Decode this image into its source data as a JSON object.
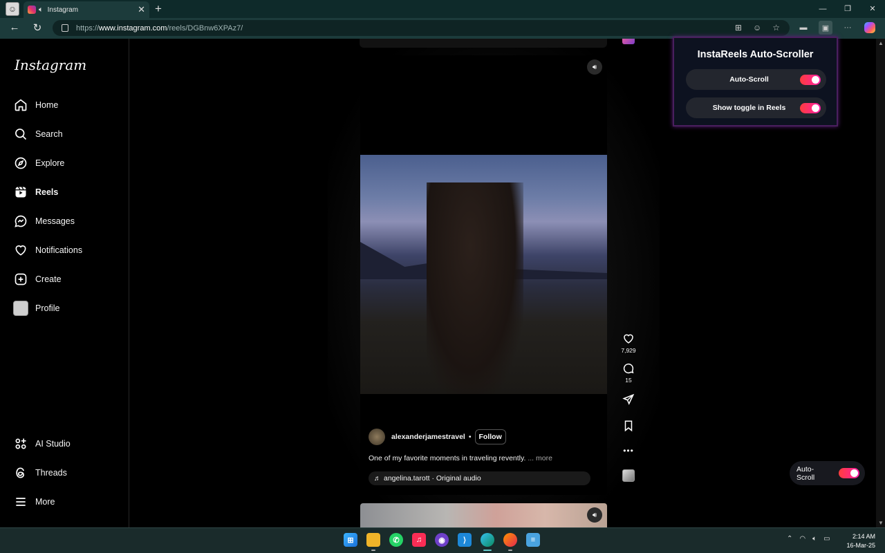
{
  "browser": {
    "tab_title": "Instagram",
    "url_prefix": "https://",
    "url_domain": "www.instagram.com",
    "url_path": "/reels/DGBnw6XPAz7/"
  },
  "instagram": {
    "logo": "Instagram",
    "nav": [
      {
        "label": "Home",
        "icon": "home-icon"
      },
      {
        "label": "Search",
        "icon": "search-icon"
      },
      {
        "label": "Explore",
        "icon": "explore-icon"
      },
      {
        "label": "Reels",
        "icon": "reels-icon"
      },
      {
        "label": "Messages",
        "icon": "messages-icon"
      },
      {
        "label": "Notifications",
        "icon": "heart-icon"
      },
      {
        "label": "Create",
        "icon": "plus-icon"
      },
      {
        "label": "Profile",
        "icon": "avatar"
      }
    ],
    "nav_bottom": [
      {
        "label": "AI Studio",
        "icon": "ai-studio-icon"
      },
      {
        "label": "Threads",
        "icon": "threads-icon"
      },
      {
        "label": "More",
        "icon": "menu-icon"
      }
    ],
    "reel": {
      "username": "alexanderjamestravel",
      "separator": "•",
      "follow_label": "Follow",
      "caption": "One of my favorite moments in traveling revently.",
      "more_label": "... more",
      "audio": "angelina.tarott · Original audio",
      "likes": "7,929",
      "comments": "15"
    }
  },
  "extension": {
    "title": "InstaReels Auto-Scroller",
    "rows": [
      {
        "label": "Auto-Scroll",
        "enabled": true
      },
      {
        "label": "Show toggle in Reels",
        "enabled": true
      }
    ],
    "floating_label": "Auto-Scroll",
    "toggle_color": "#ff1fa8"
  },
  "taskbar": {
    "time": "2:14 AM",
    "date": "16-Mar-25"
  }
}
